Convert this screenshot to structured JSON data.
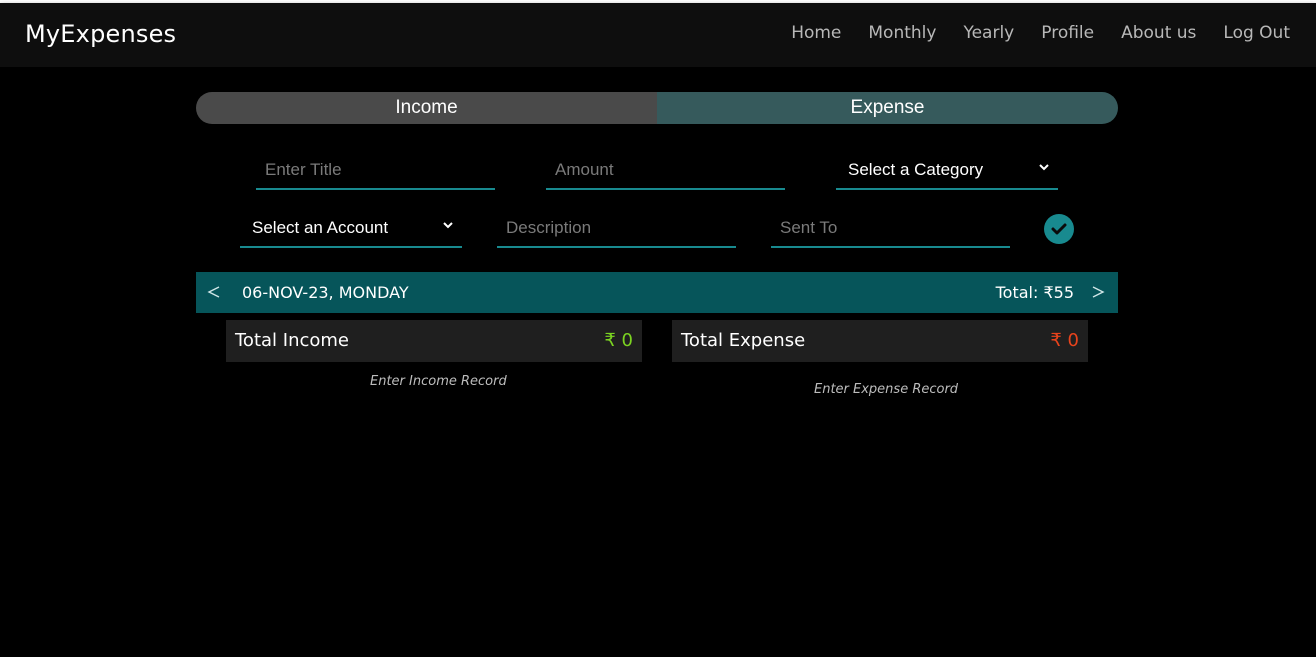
{
  "app": {
    "brand": "MyExpenses"
  },
  "nav": {
    "items": [
      {
        "label": "Home"
      },
      {
        "label": "Monthly"
      },
      {
        "label": "Yearly"
      },
      {
        "label": "Profile"
      },
      {
        "label": "About us"
      },
      {
        "label": "Log Out"
      }
    ]
  },
  "toggle": {
    "income_label": "Income",
    "expense_label": "Expense",
    "active": "Expense"
  },
  "form": {
    "title_placeholder": "Enter Title",
    "amount_placeholder": "Amount",
    "category_value": "Select a Category",
    "account_value": "Select an Account",
    "description_placeholder": "Description",
    "sent_to_placeholder": "Sent To",
    "submit_icon": "check-circle-icon"
  },
  "datebar": {
    "date": "06-NOV-23, MONDAY",
    "total": "Total: ₹55",
    "prev_icon": "chevron-left-icon",
    "next_icon": "chevron-right-icon"
  },
  "summary": {
    "income": {
      "label": "Total Income",
      "value": "₹ 0",
      "hint": "Enter Income Record",
      "color": "#7bd321"
    },
    "expense": {
      "label": "Total Expense",
      "value": "₹ 0",
      "hint": "Enter Expense Record",
      "color": "#e8431c"
    }
  },
  "colors": {
    "accent": "#188a8f",
    "datebar": "#06555a",
    "toggle_income": "#4a4a4a",
    "toggle_expense": "#365a5c"
  }
}
